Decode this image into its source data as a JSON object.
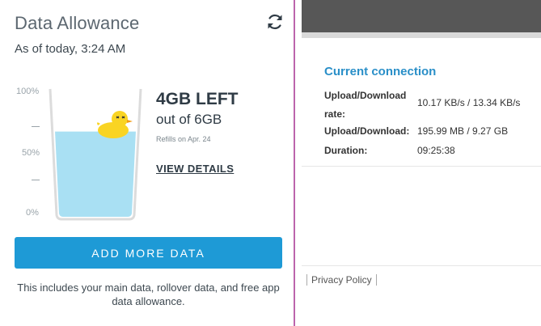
{
  "allowance": {
    "title": "Data Allowance",
    "as_of": "As of today, 3:24 AM",
    "refresh_icon": "refresh-icon",
    "axis": {
      "top": "100%",
      "mid": "50%",
      "bottom": "0%"
    },
    "fill_fraction": 0.667,
    "water_color": "#a9e0f3",
    "duck_icon": "rubber-duck-icon",
    "remaining": "4GB LEFT",
    "out_of": "out of 6GB",
    "refills": "Refills on Apr. 24",
    "view_details": "VIEW DETAILS",
    "add_button": "ADD MORE DATA",
    "footnote": "This includes your main data, rollover data, and free app data allowance."
  },
  "connection": {
    "title": "Current connection",
    "rows": [
      {
        "label": "Upload/Download rate:",
        "value": "10.17 KB/s / 13.34 KB/s"
      },
      {
        "label": "Upload/Download:",
        "value": "195.99 MB / 9.27 GB"
      },
      {
        "label": "Duration:",
        "value": "09:25:38"
      }
    ],
    "privacy": "Privacy Policy"
  },
  "colors": {
    "accent": "#1e9ad6",
    "link": "#2a8fc8"
  }
}
